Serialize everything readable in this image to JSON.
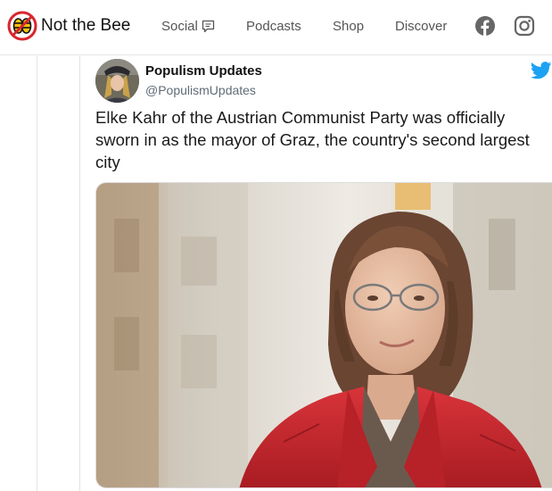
{
  "nav": {
    "logo_text": "Not the Bee",
    "items": [
      {
        "label": "Social"
      },
      {
        "label": "Podcasts"
      },
      {
        "label": "Shop"
      },
      {
        "label": "Discover"
      }
    ],
    "social_icons": [
      "facebook-icon",
      "instagram-icon"
    ]
  },
  "tweet": {
    "author_name": "Populism Updates",
    "author_handle": "@PopulismUpdates",
    "text": "Elke Kahr of the Austrian Communist Party was officially sworn in as the mayor of Graz, the country's second largest city",
    "brand_icon": "twitter-icon",
    "brand_color": "#1da1f2"
  },
  "colors": {
    "nav_text": "#555555",
    "jacket_red": "#c8242c"
  }
}
